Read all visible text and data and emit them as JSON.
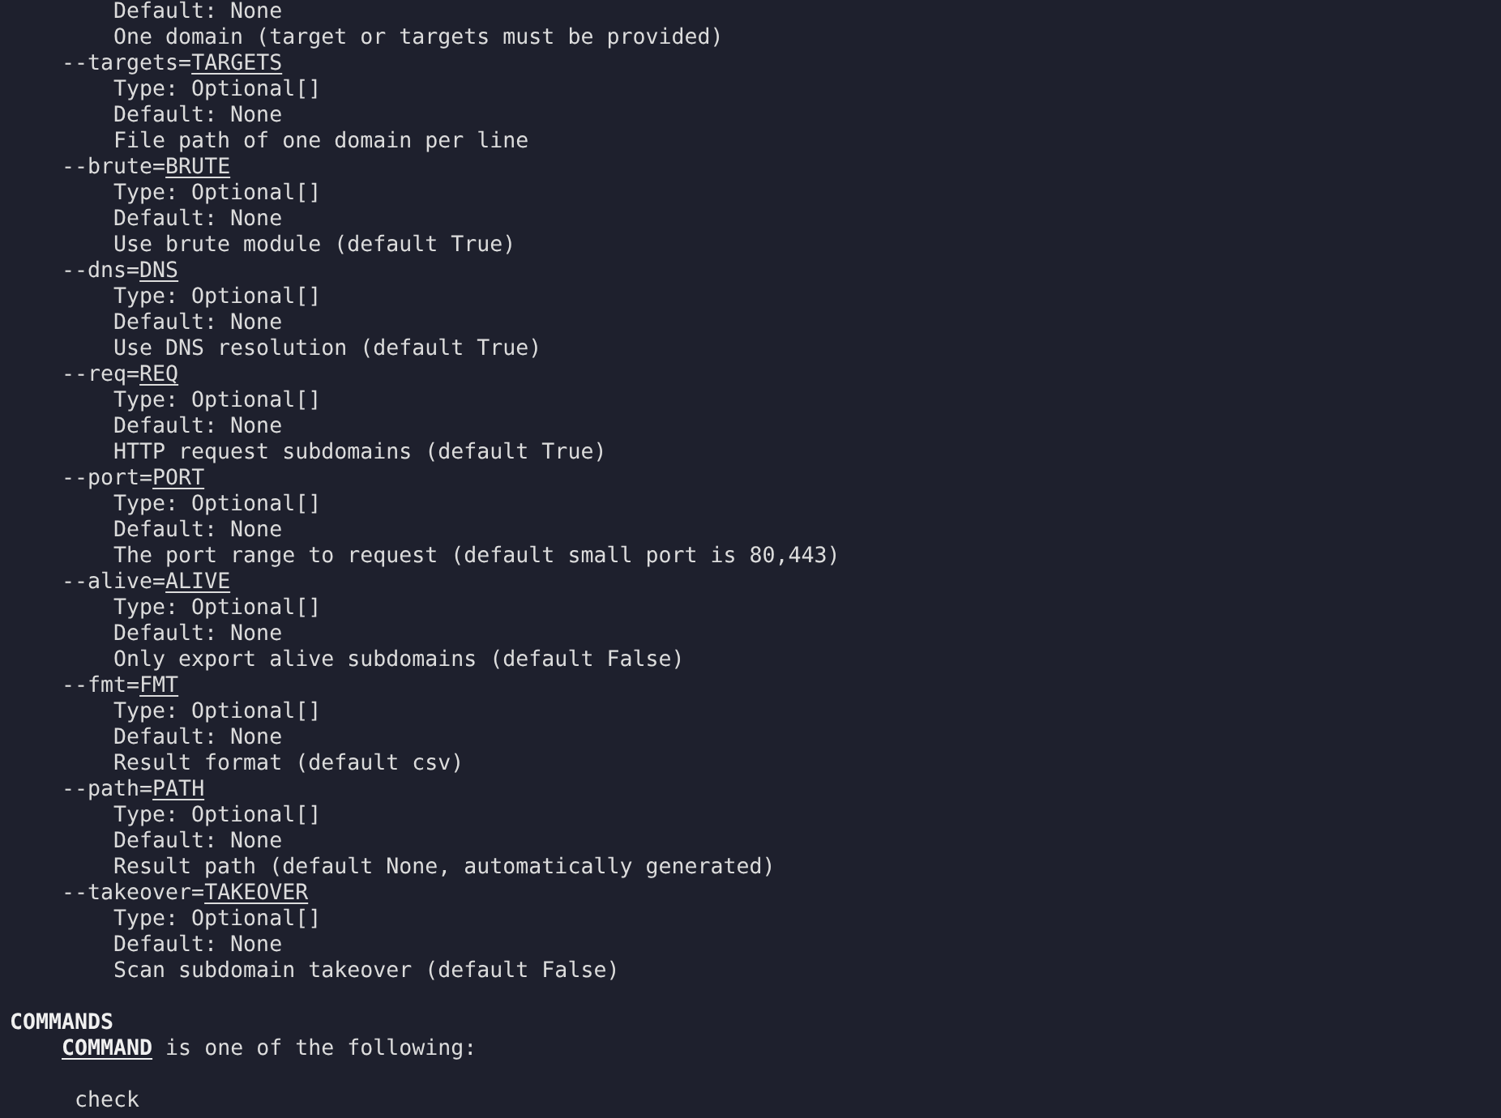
{
  "options": [
    {
      "lines": [
        "Default: None",
        "One domain (target or targets must be provided)"
      ]
    },
    {
      "flag": "--targets=",
      "metavar": "TARGETS",
      "lines": [
        "Type: Optional[]",
        "Default: None",
        "File path of one domain per line"
      ]
    },
    {
      "flag": "--brute=",
      "metavar": "BRUTE",
      "lines": [
        "Type: Optional[]",
        "Default: None",
        "Use brute module (default True)"
      ]
    },
    {
      "flag": "--dns=",
      "metavar": "DNS",
      "lines": [
        "Type: Optional[]",
        "Default: None",
        "Use DNS resolution (default True)"
      ]
    },
    {
      "flag": "--req=",
      "metavar": "REQ",
      "lines": [
        "Type: Optional[]",
        "Default: None",
        "HTTP request subdomains (default True)"
      ]
    },
    {
      "flag": "--port=",
      "metavar": "PORT",
      "lines": [
        "Type: Optional[]",
        "Default: None",
        "The port range to request (default small port is 80,443)"
      ]
    },
    {
      "flag": "--alive=",
      "metavar": "ALIVE",
      "lines": [
        "Type: Optional[]",
        "Default: None",
        "Only export alive subdomains (default False)"
      ]
    },
    {
      "flag": "--fmt=",
      "metavar": "FMT",
      "lines": [
        "Type: Optional[]",
        "Default: None",
        "Result format (default csv)"
      ]
    },
    {
      "flag": "--path=",
      "metavar": "PATH",
      "lines": [
        "Type: Optional[]",
        "Default: None",
        "Result path (default None, automatically generated)"
      ]
    },
    {
      "flag": "--takeover=",
      "metavar": "TAKEOVER",
      "lines": [
        "Type: Optional[]",
        "Default: None",
        "Scan subdomain takeover (default False)"
      ]
    }
  ],
  "commands_section": {
    "heading": "COMMANDS",
    "intro_metavar": "COMMAND",
    "intro_text": " is one of the following:",
    "commands": [
      "check"
    ]
  }
}
